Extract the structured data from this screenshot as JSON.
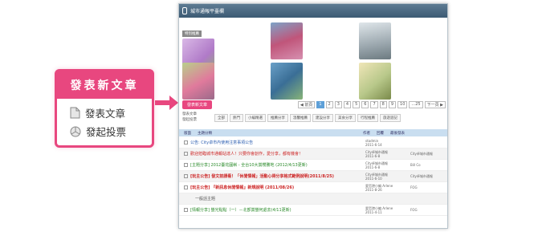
{
  "callout": {
    "title": "發表新文章",
    "items": [
      {
        "label": "發表文章",
        "icon": "document-icon"
      },
      {
        "label": "發起投票",
        "icon": "poll-icon"
      }
    ],
    "accent": "#e8477f"
  },
  "screenshot": {
    "header_title": "城市通報平臺欄",
    "featured_tag": "特別推薦",
    "tiles": [
      {
        "title": "",
        "text": ""
      },
      {
        "title": "",
        "text": ""
      },
      {
        "title": "",
        "text": ""
      },
      {
        "title": "",
        "text": ""
      },
      {
        "title": "",
        "text": ""
      },
      {
        "title": "",
        "text": ""
      }
    ],
    "post_button": "發表新文章",
    "pager": {
      "prev": "◀ 前頁",
      "pages": [
        "1",
        "2",
        "3",
        "4",
        "5",
        "6",
        "7",
        "8",
        "9",
        "10",
        "...25"
      ],
      "next": "下一頁 ▶",
      "current": "1"
    },
    "options": [
      "發表文章",
      "發起投票"
    ],
    "tabs": [
      "全部",
      "熱門",
      "小編精選",
      "推薦分享",
      "溫馨推薦",
      "建設分享",
      "美食分享",
      "行程推薦",
      "旅遊遊記"
    ],
    "table_header": [
      "版面",
      "主題分類",
      "作者",
      "回覆",
      "最後發表"
    ],
    "rows": [
      {
        "text": "公告: City卓市內使用注意事項公告",
        "meta": "stadmin",
        "meta_date": "2011-6-14",
        "meta2": "",
        "style": "blue"
      },
      {
        "text": "歡迎蒞臨城市通報站達人！只要你會創作，愛分享，都有機會！",
        "meta": "City卓城市通報",
        "meta_date": "2011-6-8",
        "meta2": "City卓城市通報",
        "style": "red"
      },
      {
        "text": "[主題分享] 2012臺花圓嶄 - 全台10大賞櫻勝地 (2012/4/13更新)",
        "meta": "City卓城市通報",
        "meta_date": "2011-6-8",
        "meta2": "Bill Co",
        "style": "green"
      },
      {
        "text": "[玩主公告] 發文前請看！「休閒情報」活動心得分享格式範例說明(2011/8/25)",
        "meta": "City卓城市通報",
        "meta_date": "2011-6-10",
        "meta2": "City卓城市通報",
        "style": "redbold"
      },
      {
        "text": "[玩主公告] 『新訊息休閒情報』新規說明 (2011/08/26)",
        "meta": "愛哲港小編 Arlene",
        "meta_date": "2011-8-26",
        "meta2": "FOG",
        "style": "redbold"
      },
      {
        "text": "一般話主題",
        "meta": "",
        "meta_date": "",
        "meta2": "",
        "style": "section"
      },
      {
        "text": "[情報分享] 螢光點點（一）－北部賞螢何處去(4/11更新)",
        "meta": "愛哲港小編 Arlene",
        "meta_date": "2011-4-11",
        "meta2": "FOG",
        "style": "green"
      }
    ]
  }
}
